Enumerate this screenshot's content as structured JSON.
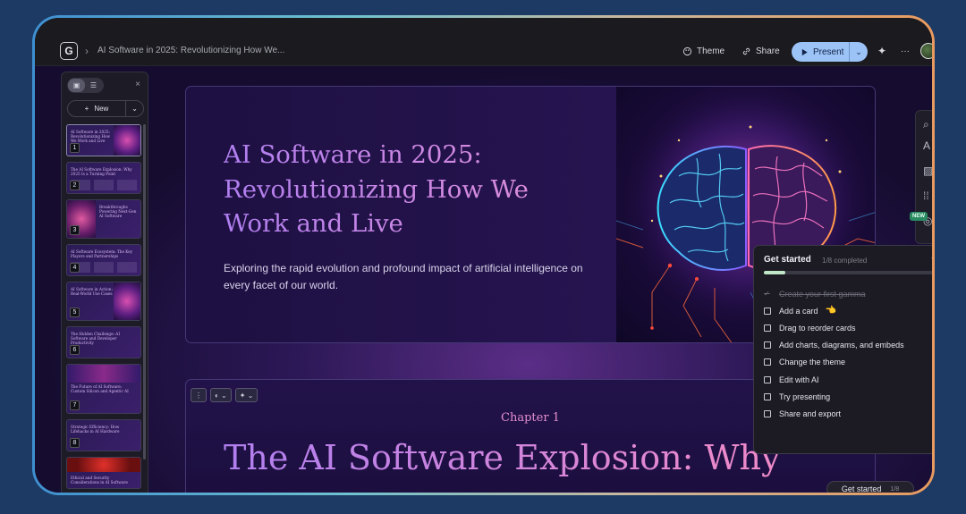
{
  "header": {
    "logo_letter": "G",
    "doc_title": "AI Software in 2025: Revolutionizing How We...",
    "theme_label": "Theme",
    "share_label": "Share",
    "present_label": "Present",
    "more_label": "···"
  },
  "sidebar": {
    "new_label": "New",
    "close_label": "×",
    "thumbnails": [
      {
        "num": "1",
        "title": "AI Software in 2025: Revolutionizing How We Work and Live"
      },
      {
        "num": "2",
        "title": "The AI Software Explosion: Why 2025 Is a Turning Point"
      },
      {
        "num": "3",
        "title": "Breakthroughs Powering Next-Gen AI Software"
      },
      {
        "num": "4",
        "title": "AI Software Ecosystem: The Key Players and Partnerships"
      },
      {
        "num": "5",
        "title": "AI Software in Action: Real-World Use Cases"
      },
      {
        "num": "6",
        "title": "The Hidden Challenge: AI Software and Developer Productivity"
      },
      {
        "num": "7",
        "title": "The Future of AI Software: Custom Silicon and Agentic AI"
      },
      {
        "num": "8",
        "title": "Strategic Efficiency: How Lifehacks in AI Hardware"
      },
      {
        "num": "",
        "title": "Ethical and Security Considerations in AI Software"
      }
    ]
  },
  "slide1": {
    "title": "AI Software in 2025: Revolutionizing How We Work and Live",
    "subtitle": "Exploring the rapid evolution and profound impact of artificial intelligence on every facet of our world."
  },
  "slide2": {
    "chapter": "Chapter 1",
    "title": "The AI Software Explosion: Why"
  },
  "tool_strip": {
    "badge": "NEW"
  },
  "get_started": {
    "title": "Get started",
    "count": "1/8 completed",
    "progress": 0.125,
    "items": [
      {
        "label": "Create your first gamma",
        "done": true
      },
      {
        "label": "Add a card",
        "done": false
      },
      {
        "label": "Drag to reorder cards",
        "done": false
      },
      {
        "label": "Add charts, diagrams, and embeds",
        "done": false
      },
      {
        "label": "Change the theme",
        "done": false
      },
      {
        "label": "Edit with AI",
        "done": false
      },
      {
        "label": "Try presenting",
        "done": false
      },
      {
        "label": "Share and export",
        "done": false
      }
    ],
    "pill_label": "Get started",
    "pill_count": "1/8"
  }
}
